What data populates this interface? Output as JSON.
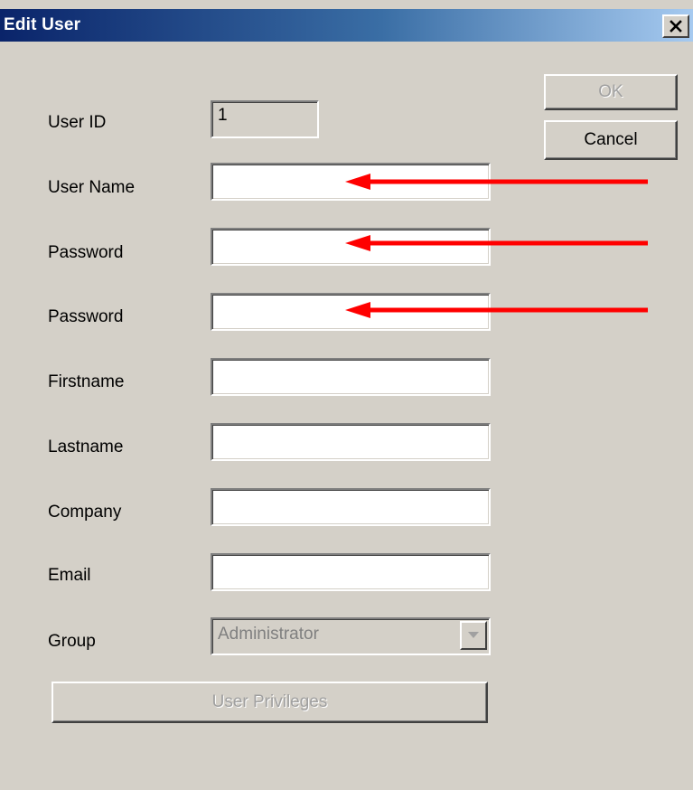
{
  "window": {
    "title": "Edit User",
    "close_glyph": "close-icon"
  },
  "buttons": {
    "ok": "OK",
    "cancel": "Cancel",
    "privileges": "User Privileges"
  },
  "fields": {
    "user_id": {
      "label": "User ID",
      "value": "1"
    },
    "user_name": {
      "label": "User Name",
      "value": ""
    },
    "password": {
      "label": "Password",
      "value": ""
    },
    "password_confirm": {
      "label": "Password",
      "value": ""
    },
    "firstname": {
      "label": "Firstname",
      "value": ""
    },
    "lastname": {
      "label": "Lastname",
      "value": ""
    },
    "company": {
      "label": "Company",
      "value": ""
    },
    "email": {
      "label": "Email",
      "value": ""
    },
    "group": {
      "label": "Group",
      "value": "Administrator"
    }
  },
  "annotation": {
    "arrow_color": "#ff0000"
  }
}
